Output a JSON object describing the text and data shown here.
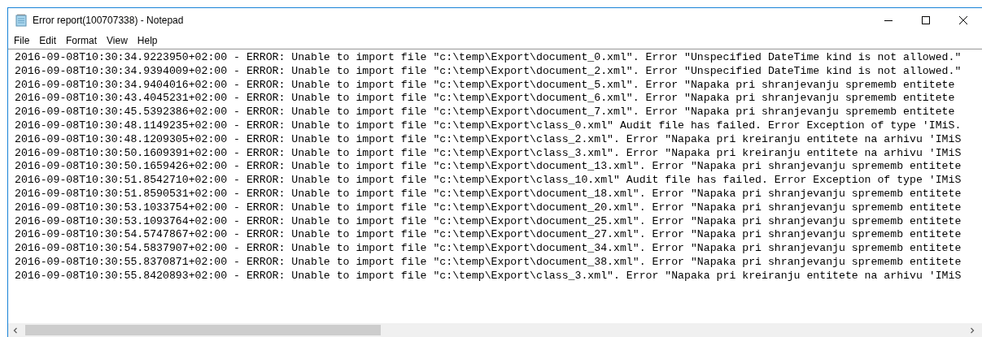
{
  "window": {
    "title": "Error report(100707338) - Notepad"
  },
  "menu": [
    "File",
    "Edit",
    "Format",
    "View",
    "Help"
  ],
  "document_lines": [
    "2016-09-08T10:30:34.9223950+02:00 - ERROR: Unable to import file \"c:\\temp\\Export\\document_0.xml\". Error \"Unspecified DateTime kind is not allowed.\"",
    "2016-09-08T10:30:34.9394009+02:00 - ERROR: Unable to import file \"c:\\temp\\Export\\document_2.xml\". Error \"Unspecified DateTime kind is not allowed.\"",
    "2016-09-08T10:30:34.9404016+02:00 - ERROR: Unable to import file \"c:\\temp\\Export\\document_5.xml\". Error \"Napaka pri shranjevanju sprememb entitete",
    "2016-09-08T10:30:43.4045231+02:00 - ERROR: Unable to import file \"c:\\temp\\Export\\document_6.xml\". Error \"Napaka pri shranjevanju sprememb entitete",
    "2016-09-08T10:30:45.5392386+02:00 - ERROR: Unable to import file \"c:\\temp\\Export\\document_7.xml\". Error \"Napaka pri shranjevanju sprememb entitete",
    "2016-09-08T10:30:48.1149235+02:00 - ERROR: Unable to import file \"c:\\temp\\Export\\class_0.xml\" Audit file has failed. Error Exception of type 'IMiS.",
    "2016-09-08T10:30:48.1209305+02:00 - ERROR: Unable to import file \"c:\\temp\\Export\\class_2.xml\". Error \"Napaka pri kreiranju entitete na arhivu 'IMiS",
    "2016-09-08T10:30:50.1609391+02:00 - ERROR: Unable to import file \"c:\\temp\\Export\\class_3.xml\". Error \"Napaka pri kreiranju entitete na arhivu 'IMiS",
    "2016-09-08T10:30:50.1659426+02:00 - ERROR: Unable to import file \"c:\\temp\\Export\\document_13.xml\". Error \"Napaka pri shranjevanju sprememb entitete",
    "2016-09-08T10:30:51.8542710+02:00 - ERROR: Unable to import file \"c:\\temp\\Export\\class_10.xml\" Audit file has failed. Error Exception of type 'IMiS",
    "2016-09-08T10:30:51.8590531+02:00 - ERROR: Unable to import file \"c:\\temp\\Export\\document_18.xml\". Error \"Napaka pri shranjevanju sprememb entitete",
    "2016-09-08T10:30:53.1033754+02:00 - ERROR: Unable to import file \"c:\\temp\\Export\\document_20.xml\". Error \"Napaka pri shranjevanju sprememb entitete",
    "2016-09-08T10:30:53.1093764+02:00 - ERROR: Unable to import file \"c:\\temp\\Export\\document_25.xml\". Error \"Napaka pri shranjevanju sprememb entitete",
    "2016-09-08T10:30:54.5747867+02:00 - ERROR: Unable to import file \"c:\\temp\\Export\\document_27.xml\". Error \"Napaka pri shranjevanju sprememb entitete",
    "2016-09-08T10:30:54.5837907+02:00 - ERROR: Unable to import file \"c:\\temp\\Export\\document_34.xml\". Error \"Napaka pri shranjevanju sprememb entitete",
    "2016-09-08T10:30:55.8370871+02:00 - ERROR: Unable to import file \"c:\\temp\\Export\\document_38.xml\". Error \"Napaka pri shranjevanju sprememb entitete",
    "2016-09-08T10:30:55.8420893+02:00 - ERROR: Unable to import file \"c:\\temp\\Export\\class_3.xml\". Error \"Napaka pri kreiranju entitete na arhivu 'IMiS"
  ]
}
